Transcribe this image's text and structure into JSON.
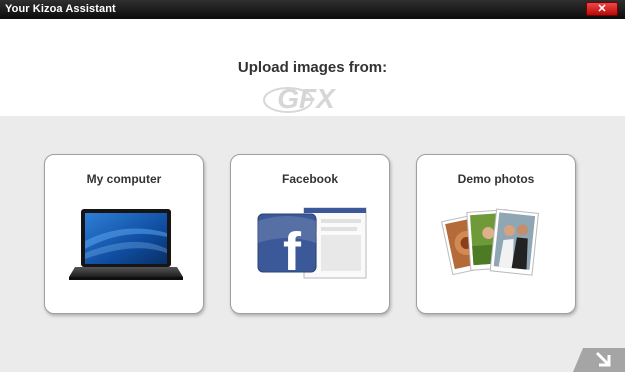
{
  "window": {
    "title": "Your Kizoa Assistant",
    "close_label": "✕"
  },
  "main": {
    "heading": "Upload images from:"
  },
  "watermark": {
    "text": "GFX"
  },
  "sources": [
    {
      "label": "My computer",
      "icon": "laptop-icon"
    },
    {
      "label": "Facebook",
      "icon": "facebook-icon"
    },
    {
      "label": "Demo photos",
      "icon": "photos-icon"
    }
  ],
  "footer": {
    "next_icon": "arrow-down-right-icon"
  },
  "colors": {
    "titlebar": "#1a1a1a",
    "close": "#d21e1e",
    "panel": "#ebebeb",
    "facebook": "#3b5998"
  }
}
